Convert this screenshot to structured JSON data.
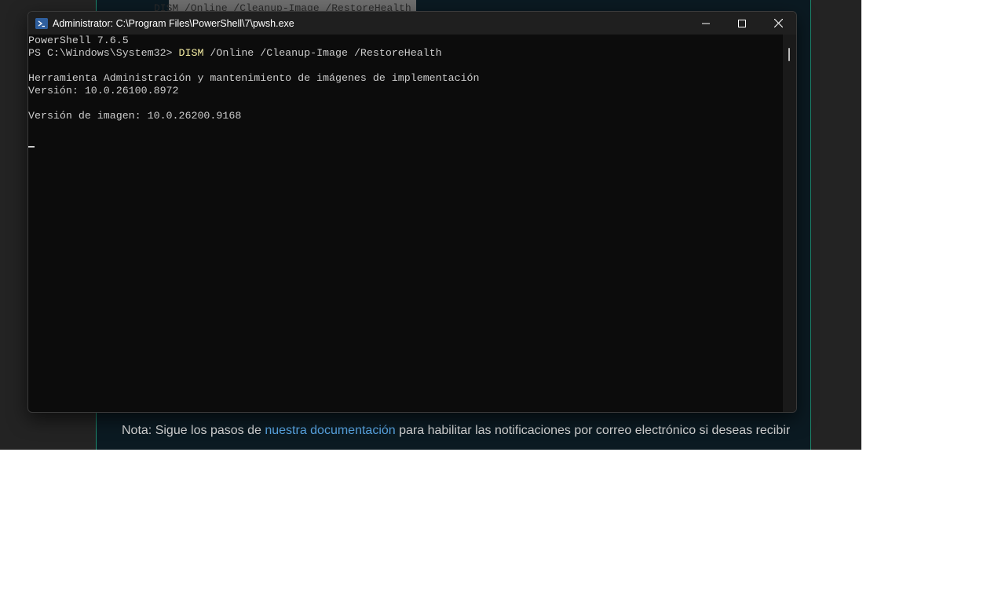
{
  "background": {
    "code_snippet": "DISM /Online /Cleanup-Image /RestoreHealth",
    "note": {
      "prefix": "Nota: Sigue los pasos de ",
      "link": "nuestra documentación",
      "suffix": " para habilitar las notificaciones por correo electrónico si deseas recibir"
    }
  },
  "window": {
    "title": "Administrator: C:\\Program Files\\PowerShell\\7\\pwsh.exe",
    "icon": "powershell-icon",
    "buttons": {
      "minimize": "minimize-icon",
      "maximize": "maximize-icon",
      "close": "close-icon"
    }
  },
  "terminal": {
    "version_line": "PowerShell 7.6.5",
    "prompt": "PS C:\\Windows\\System32> ",
    "command_name": "DISM",
    "command_args": " /Online /Cleanup-Image /RestoreHealth",
    "blank1": "",
    "tool_title": "Herramienta Administración y mantenimiento de imágenes de implementación",
    "tool_version": "Versión: 10.0.26100.8972",
    "blank2": "",
    "image_version": "Versión de imagen: 10.0.26200.9168",
    "blank3": ""
  },
  "colors": {
    "terminal_bg": "#0c0c0c",
    "terminal_text": "#cccccc",
    "command_highlight": "#f9f1a5",
    "link": "#5aa7e6"
  }
}
